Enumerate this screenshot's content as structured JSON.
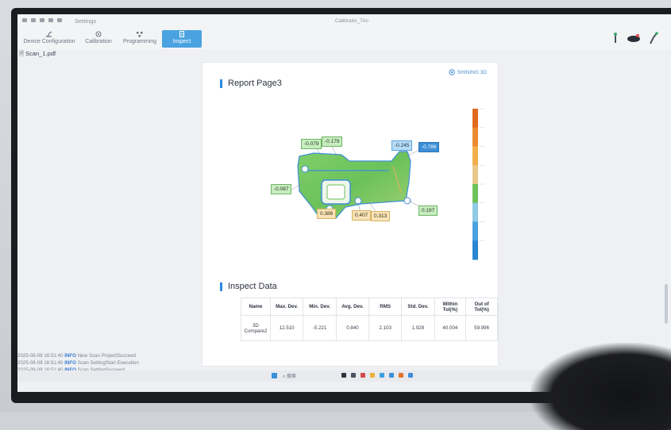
{
  "app": {
    "settings_label": "Settings",
    "window_title": "Calibratio_Trio"
  },
  "toolbar": {
    "items": [
      {
        "label": "Device Configuration"
      },
      {
        "label": "Calibration"
      },
      {
        "label": "Programming"
      },
      {
        "label": "Inspect"
      }
    ]
  },
  "file_tab": "Scan_1.pdf",
  "report": {
    "logo_text": "SHINING 3D",
    "page_title": "Report Page3",
    "section_title": "Inspect Data",
    "deviation_labels": [
      {
        "value": "-0.079",
        "style": "green"
      },
      {
        "value": "-0.179",
        "style": "green"
      },
      {
        "value": "-0.245",
        "style": "blue"
      },
      {
        "value": "-0.786",
        "style": "dblue"
      },
      {
        "value": "-0.087",
        "style": "green"
      },
      {
        "value": "0.386",
        "style": "yellow"
      },
      {
        "value": "0.407",
        "style": "yellow"
      },
      {
        "value": "0.313",
        "style": "yellow"
      },
      {
        "value": "0.197",
        "style": "green"
      }
    ],
    "color_scale": [
      "#e06a1f",
      "#ec8a2e",
      "#f2b04a",
      "#e9c98a",
      "#6dc25a",
      "#8ecbe6",
      "#4aa3e0",
      "#2a86d2"
    ],
    "table": {
      "headers": [
        "Name",
        "Max. Dev.",
        "Min. Dev.",
        "Avg. Dev.",
        "RMS",
        "Std. Dev.",
        "Within Tol(%)",
        "Out of Tol(%)"
      ],
      "rows": [
        [
          "3D Compare2",
          "12.510",
          "-5.221",
          "0.840",
          "2.103",
          "1.928",
          "40.004",
          "59.996"
        ]
      ]
    }
  },
  "log": [
    {
      "time": "2025-08-08 16:51:40",
      "level": "INFO",
      "msg": "New Scan ProjectSucceed"
    },
    {
      "time": "2025-08-08 16:51:40",
      "level": "INFO",
      "msg": "Scan SettingStart Execution"
    },
    {
      "time": "2025-08-08 16:51:40",
      "level": "INFO",
      "msg": "Scan SettingSucceed"
    }
  ],
  "taskbar": {
    "search_label": "搜索"
  }
}
